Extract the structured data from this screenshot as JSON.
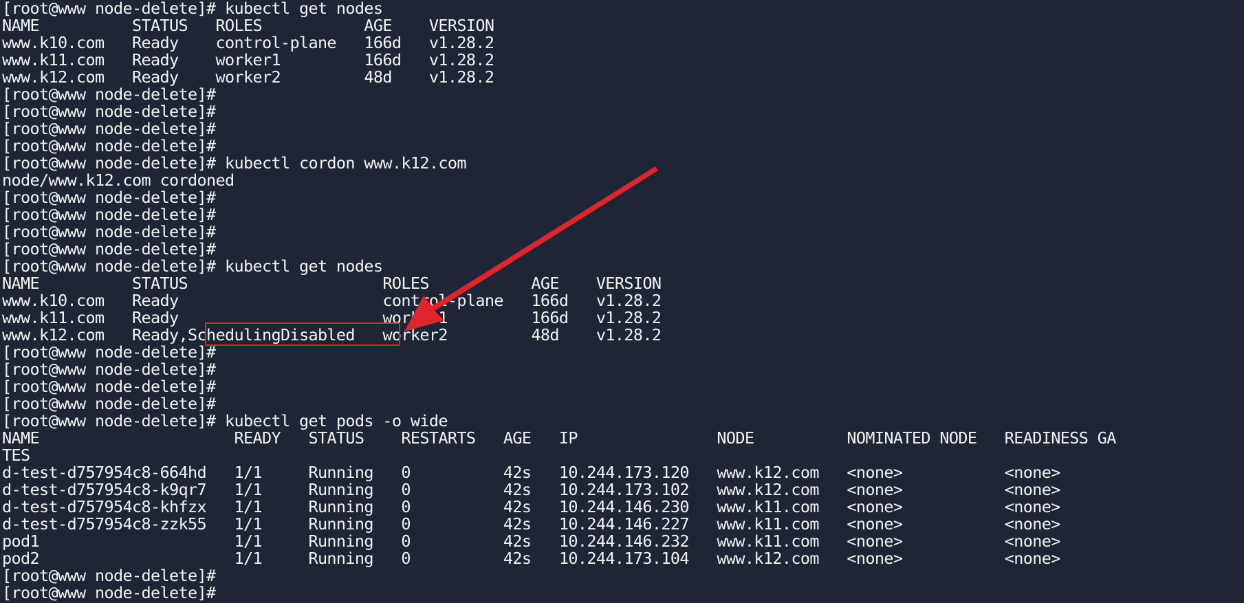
{
  "terminal": {
    "prompt": "[root@www node-delete]#",
    "lines": [
      "[root@www node-delete]# kubectl get nodes",
      "NAME          STATUS   ROLES           AGE    VERSION",
      "www.k10.com   Ready    control-plane   166d   v1.28.2",
      "www.k11.com   Ready    worker1         166d   v1.28.2",
      "www.k12.com   Ready    worker2         48d    v1.28.2",
      "[root@www node-delete]#",
      "[root@www node-delete]#",
      "[root@www node-delete]#",
      "[root@www node-delete]#",
      "[root@www node-delete]# kubectl cordon www.k12.com",
      "node/www.k12.com cordoned",
      "[root@www node-delete]#",
      "[root@www node-delete]#",
      "[root@www node-delete]#",
      "[root@www node-delete]#",
      "[root@www node-delete]# kubectl get nodes",
      "NAME          STATUS                     ROLES           AGE    VERSION",
      "www.k10.com   Ready                      control-plane   166d   v1.28.2",
      "www.k11.com   Ready                      worker1         166d   v1.28.2",
      "www.k12.com   Ready,SchedulingDisabled   worker2         48d    v1.28.2",
      "[root@www node-delete]#",
      "[root@www node-delete]#",
      "[root@www node-delete]#",
      "[root@www node-delete]#",
      "[root@www node-delete]# kubectl get pods -o wide",
      "NAME                     READY   STATUS    RESTARTS   AGE   IP               NODE          NOMINATED NODE   READINESS GA",
      "TES",
      "d-test-d757954c8-664hd   1/1     Running   0          42s   10.244.173.120   www.k12.com   <none>           <none>",
      "d-test-d757954c8-k9qr7   1/1     Running   0          42s   10.244.173.102   www.k12.com   <none>           <none>",
      "d-test-d757954c8-khfzx   1/1     Running   0          42s   10.244.146.230   www.k11.com   <none>           <none>",
      "d-test-d757954c8-zzk55   1/1     Running   0          42s   10.244.146.227   www.k11.com   <none>           <none>",
      "pod1                     1/1     Running   0          42s   10.244.146.232   www.k11.com   <none>           <none>",
      "pod2                     1/1     Running   0          42s   10.244.173.104   www.k12.com   <none>           <none>",
      "[root@www node-delete]#",
      "[root@www node-delete]#"
    ]
  },
  "annotation": {
    "highlighted_text": "SchedulingDisabled",
    "color": "#e0242b",
    "arrow_target": "scheduling-disabled-status"
  },
  "colors": {
    "background": "#1e2636",
    "foreground": "#f2f2f2"
  }
}
